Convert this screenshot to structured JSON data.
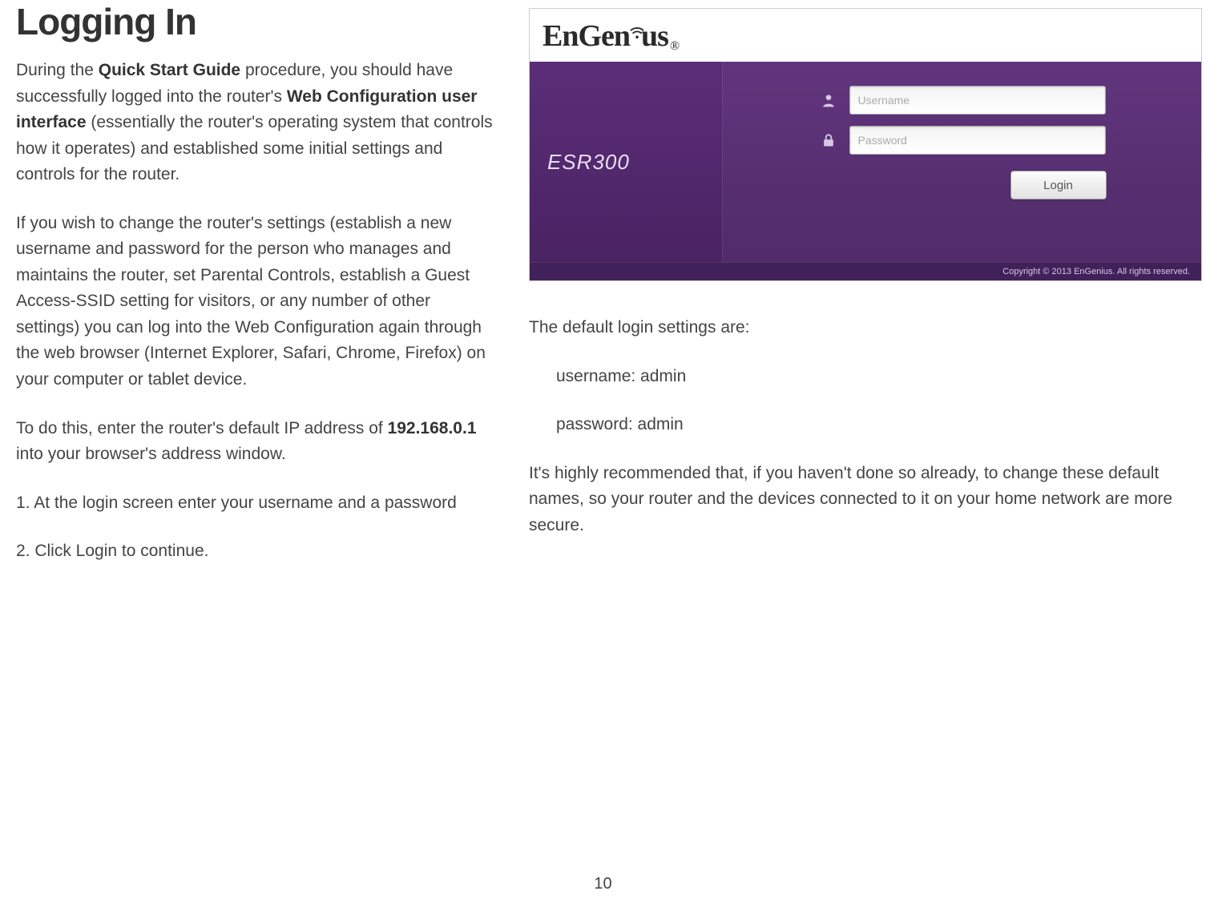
{
  "heading": "Logging In",
  "left": {
    "p1_pre": "During the ",
    "p1_b1": "Quick Start Guide",
    "p1_mid": " procedure, you should have successfully logged into the router's ",
    "p1_b2": "Web Configuration user interface",
    "p1_post": " (essentially the router's operating system that controls how it operates) and established some initial settings and controls for the router.",
    "p2": "If you wish to change the router's settings (establish a new username and password for the person who manages and maintains the router, set Parental Controls, establish a Guest Access-SSID setting for visitors, or any number of other settings) you can log into the Web Configuration again through the web browser (Internet Explorer, Safari, Chrome, Firefox) on your computer or tablet device.",
    "p3_pre": "To do this, enter the router's default IP address of ",
    "p3_b1": "192.168.0.1",
    "p3_post": " into your browser's address window.",
    "step1": "1. At the login screen enter your username and a password",
    "step2": "2. Click Login to continue."
  },
  "screenshot": {
    "brand_pre": "EnGen",
    "brand_post": "us",
    "brand_reg": "®",
    "model": "ESR300",
    "username_placeholder": "Username",
    "password_placeholder": "Password",
    "login_button": "Login",
    "copyright": "Copyright © 2013 EnGenius. All rights reserved."
  },
  "right": {
    "defaults_intro": "The default login settings are:",
    "defaults_username": "username: admin",
    "defaults_password": "password: admin",
    "recommend": "It's highly recommended that, if you haven't done so already, to change these default names, so your router and the devices connected to it on your home network are more secure."
  },
  "page_number": "10"
}
